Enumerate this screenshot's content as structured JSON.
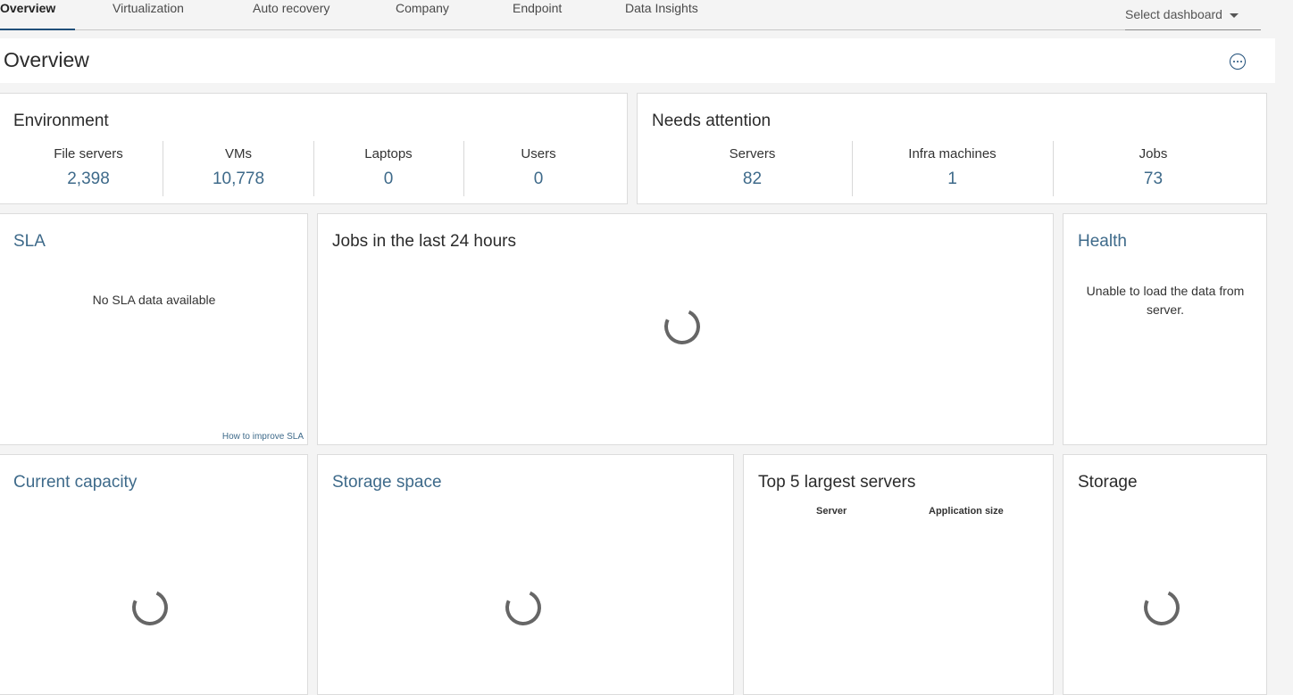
{
  "tabs": [
    {
      "label": "Overview",
      "active": true
    },
    {
      "label": "Virtualization",
      "active": false
    },
    {
      "label": "Auto recovery",
      "active": false
    },
    {
      "label": "Company",
      "active": false
    },
    {
      "label": "Endpoint",
      "active": false
    },
    {
      "label": "Data Insights",
      "active": false
    }
  ],
  "dashboard_select": {
    "placeholder": "Select dashboard"
  },
  "page": {
    "title": "Overview",
    "more_icon": "ellipsis-circle-icon"
  },
  "environment": {
    "title": "Environment",
    "metrics": [
      {
        "label": "File servers",
        "value": "2,398"
      },
      {
        "label": "VMs",
        "value": "10,778"
      },
      {
        "label": "Laptops",
        "value": "0"
      },
      {
        "label": "Users",
        "value": "0"
      }
    ]
  },
  "needs_attention": {
    "title": "Needs attention",
    "metrics": [
      {
        "label": "Servers",
        "value": "82"
      },
      {
        "label": "Infra machines",
        "value": "1"
      },
      {
        "label": "Jobs",
        "value": "73"
      }
    ]
  },
  "sla": {
    "title": "SLA",
    "message": "No SLA data available",
    "help_link": "How to improve SLA"
  },
  "jobs24": {
    "title": "Jobs in the last 24 hours",
    "loading_icon": "spinner-icon"
  },
  "health": {
    "title": "Health",
    "message": "Unable to load the data from server."
  },
  "capacity": {
    "title": "Current capacity",
    "loading_icon": "spinner-icon"
  },
  "storage_space": {
    "title": "Storage space",
    "loading_icon": "spinner-icon"
  },
  "top5": {
    "title": "Top 5 largest servers",
    "columns": [
      "Server",
      "Application size"
    ]
  },
  "storage": {
    "title": "Storage",
    "loading_icon": "spinner-icon"
  },
  "colors": {
    "accent": "#1f4e79",
    "value_link": "#3e6a8a",
    "background": "#f4f4f4"
  }
}
